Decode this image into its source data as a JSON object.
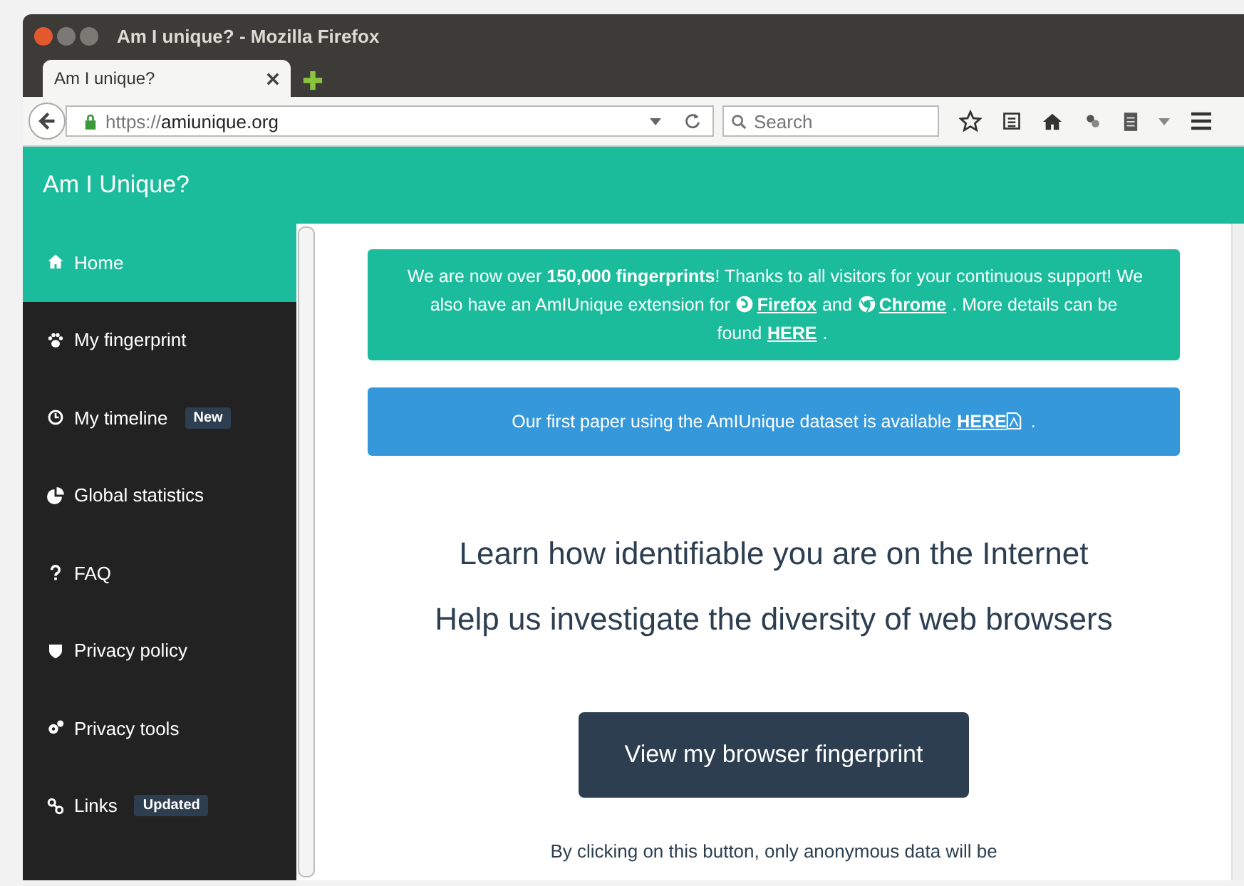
{
  "window": {
    "title": "Am I unique? - Mozilla Firefox"
  },
  "tabs": [
    {
      "label": "Am I unique?",
      "selected": true
    }
  ],
  "address_bar": {
    "scheme": "https://",
    "host": "amiunique.org"
  },
  "search": {
    "placeholder": "Search"
  },
  "site": {
    "title": "Am I Unique?"
  },
  "sidebar": {
    "items": [
      {
        "label": "Home",
        "selected": true
      },
      {
        "label": "My fingerprint",
        "selected": false
      },
      {
        "label": "My timeline",
        "selected": false,
        "badge": "New"
      },
      {
        "label": "Global statistics",
        "selected": false
      },
      {
        "label": "FAQ",
        "selected": false
      },
      {
        "label": "Privacy policy",
        "selected": false
      },
      {
        "label": "Privacy tools",
        "selected": false
      },
      {
        "label": "Links",
        "selected": false,
        "badge": "Updated"
      }
    ]
  },
  "notices": [
    {
      "kind": "success",
      "parts": [
        {
          "kind": "text",
          "text": "We are now over **150,000 fingerprints**! Thanks to all visitors for your continuous support! We also have an AmIUnique extension for"
        },
        {
          "kind": "link",
          "text": "Firefox"
        },
        {
          "kind": "text",
          "text": "and"
        },
        {
          "kind": "link",
          "text": "Chrome"
        },
        {
          "kind": "text",
          "text": ". More details can be found"
        },
        {
          "kind": "link",
          "text": "HERE"
        },
        {
          "kind": "text",
          "text": "."
        }
      ]
    },
    {
      "kind": "info",
      "parts": [
        {
          "kind": "text",
          "text": "Our first paper using the AmIUnique dataset is available"
        },
        {
          "kind": "link",
          "text": "HERE"
        },
        {
          "kind": "text",
          "text": "."
        }
      ]
    }
  ],
  "headlines": [
    "Learn how identifiable you are on the Internet",
    "Help us investigate the diversity of web browsers"
  ],
  "cta": {
    "label": "View my browser fingerprint"
  },
  "footnote": "By clicking on this button, only anonymous data will be"
}
